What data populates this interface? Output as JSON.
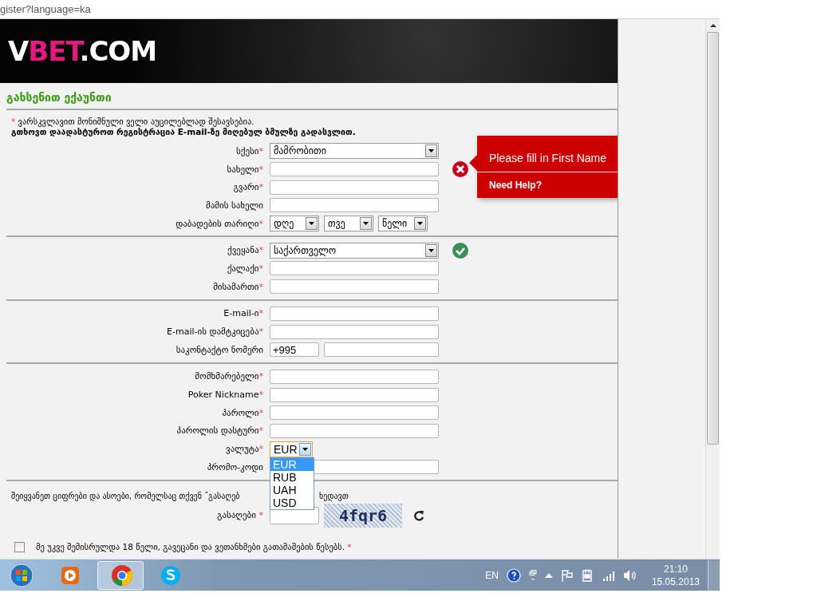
{
  "address_bar": {
    "url": "gister?language=ka"
  },
  "header": {
    "logo_parts": [
      {
        "text": "V",
        "accent": false
      },
      {
        "text": "BET",
        "accent": true
      },
      {
        "text": ".COM",
        "accent": false
      }
    ]
  },
  "form": {
    "title": "გახსენით ექაუნთი",
    "note_mark": "*",
    "note": "ვარსკვლავით მონიშნული ველი აუცილებლად შესავსებია.",
    "confirm_note": "გთხოვთ დაადასტუროთ რეგისტრაცია E-mail-ზე მიღებულ ბმულზე გადასვლით.",
    "sections": [
      {
        "fields": [
          {
            "kind": "select",
            "label": "სქესი",
            "required_mark": "*",
            "value": "მამრობითი",
            "error": false,
            "valid": false
          },
          {
            "kind": "text",
            "label": "სახელი",
            "required_mark": "*",
            "error": true,
            "valid": false
          },
          {
            "kind": "text",
            "label": "გვარი",
            "required_mark": "*",
            "error": false,
            "valid": false
          },
          {
            "kind": "text",
            "label": "მამის სახელი",
            "error": false,
            "valid": false
          },
          {
            "kind": "date",
            "label": "დაბადების თარიღი",
            "required_mark": "*",
            "parts": [
              {
                "value": "დღე"
              },
              {
                "value": "თვე"
              },
              {
                "value": "წელი"
              }
            ],
            "error": false,
            "valid": false
          }
        ]
      },
      {
        "fields": [
          {
            "kind": "select",
            "label": "ქვეყანა",
            "required_mark": "*",
            "value": "საქართველო",
            "error": false,
            "valid": true
          },
          {
            "kind": "text",
            "label": "ქალაქი",
            "required_mark": "*",
            "error": false,
            "valid": false
          },
          {
            "kind": "text",
            "label": "მისამართი",
            "required_mark": "*",
            "error": false,
            "valid": false
          }
        ]
      },
      {
        "fields": [
          {
            "kind": "text",
            "label": "E-mail-ი",
            "required_mark": "*",
            "error": false,
            "valid": false
          },
          {
            "kind": "text",
            "label": "E-mail-ის დამტკიცება",
            "required_mark": "*",
            "error": false,
            "valid": false
          },
          {
            "kind": "phone",
            "label": "საკონტაქტო ნომერი",
            "code": "+995",
            "error": false,
            "valid": false
          }
        ]
      },
      {
        "fields": [
          {
            "kind": "text",
            "label": "მომხმარებელი",
            "required_mark": "*",
            "error": false,
            "valid": false
          },
          {
            "kind": "text",
            "label": "Poker Nickname",
            "required_mark": "*",
            "error": false,
            "valid": false
          },
          {
            "kind": "text",
            "label": "პაროლი",
            "required_mark": "*",
            "error": false,
            "valid": false
          },
          {
            "kind": "text",
            "label": "პაროლის დასტური",
            "required_mark": "*",
            "error": false,
            "valid": false
          },
          {
            "kind": "currency",
            "label": "ვალუტა",
            "required_mark": "*",
            "value": "EUR",
            "open": true,
            "options": [
              {
                "label": "EUR",
                "selected": true
              },
              {
                "label": "RUB",
                "selected": false
              },
              {
                "label": "UAH",
                "selected": false
              },
              {
                "label": "USD",
                "selected": false
              }
            ],
            "error": false,
            "valid": false
          },
          {
            "kind": "text",
            "label": "პრომო-კოდი",
            "error": false,
            "valid": false
          }
        ]
      }
    ],
    "captcha": {
      "instruction_start": "შეიყვანეთ ციფრები და ასოები, რომელსაც თქვენ ˝გასაღებ",
      "instruction_end": "ხედავთ",
      "label": "გასაღები",
      "required_mark": "*",
      "code": "4fqr6"
    },
    "agreement": {
      "label": "მე უკვე შემისრულდა 18 წელი, გავეცანი და ვეთანხმები გათამაშების წესებს.",
      "required_mark": "*",
      "checked": false
    }
  },
  "tooltip": {
    "message": "Please fill in First Name",
    "help": "Need Help?"
  },
  "taskbar": {
    "apps": [
      {
        "kind": "media",
        "selected": false
      },
      {
        "kind": "chrome",
        "selected": true
      },
      {
        "kind": "skype",
        "selected": false
      }
    ],
    "language": "EN",
    "time": "21:10",
    "date": "15.05.2013"
  }
}
